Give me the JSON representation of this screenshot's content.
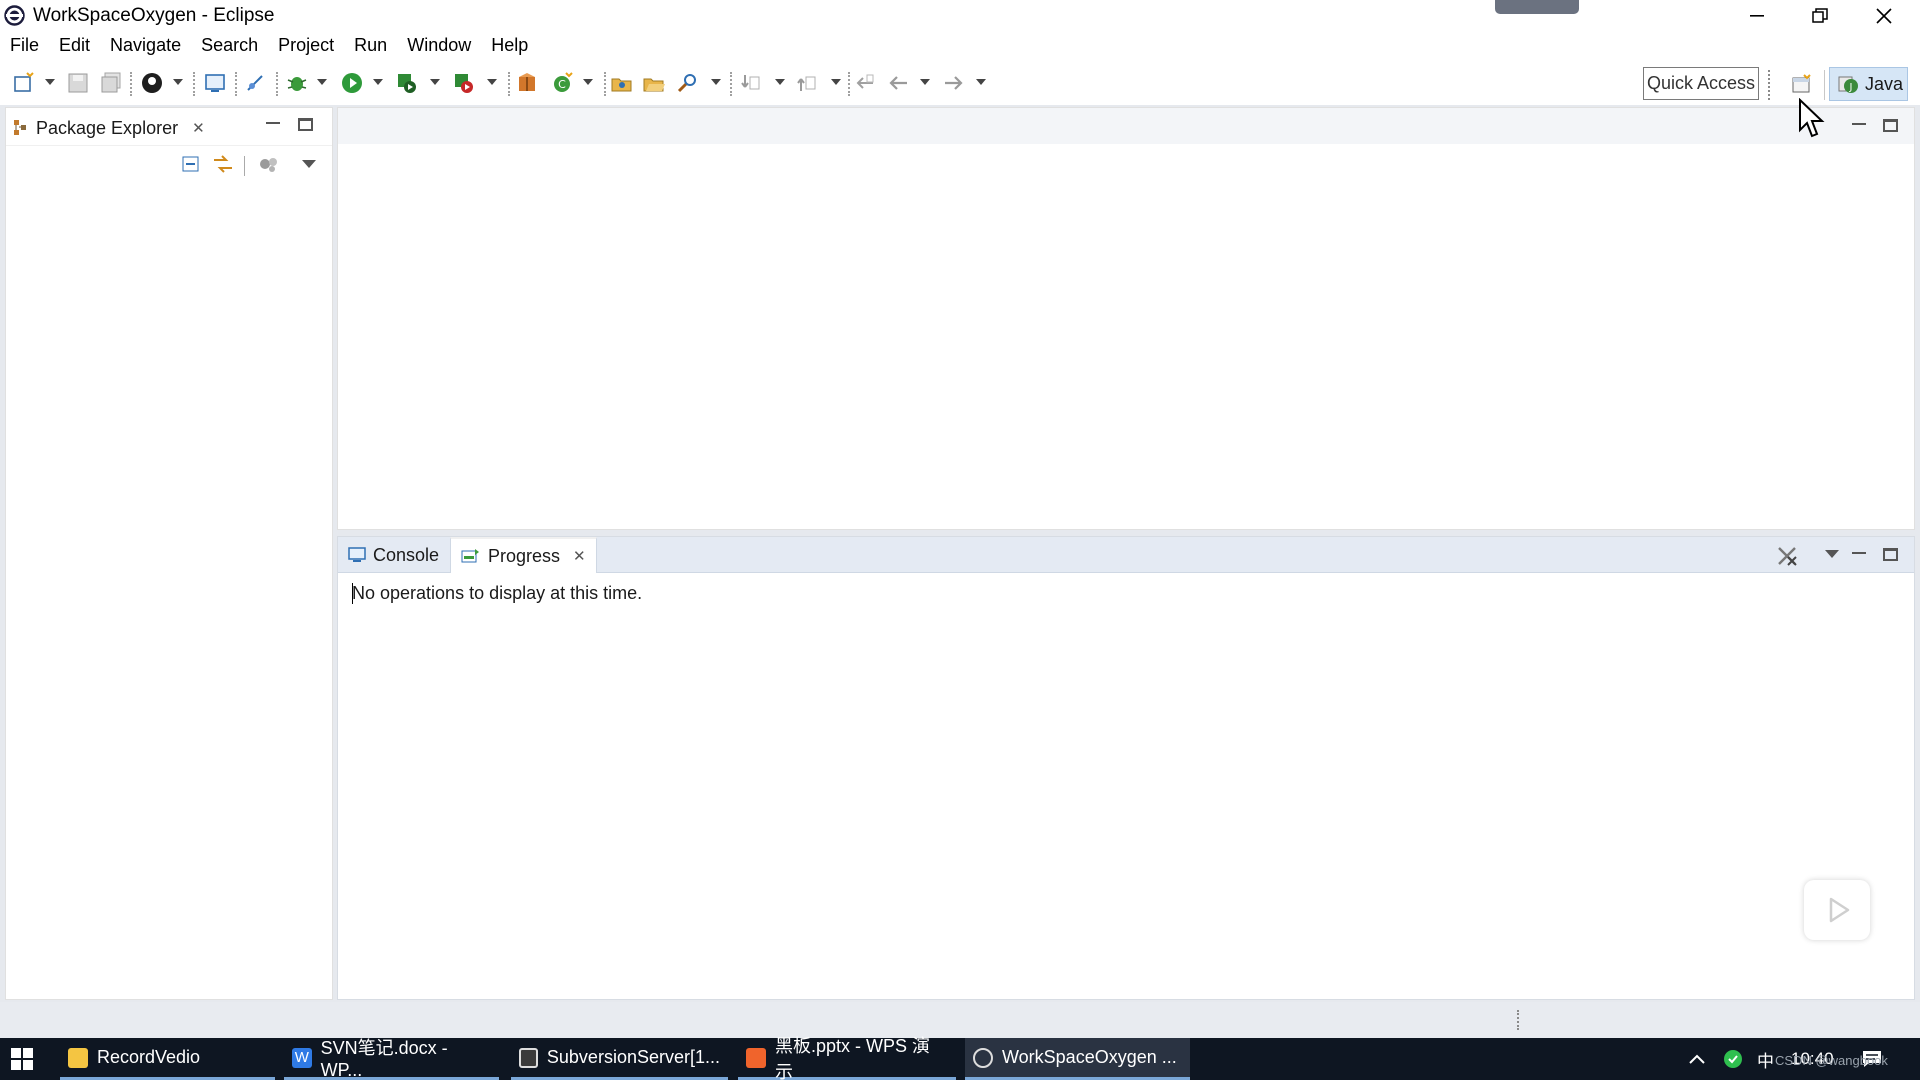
{
  "window": {
    "title": "WorkSpaceOxygen - Eclipse"
  },
  "menu": {
    "items": [
      "File",
      "Edit",
      "Navigate",
      "Search",
      "Project",
      "Run",
      "Window",
      "Help"
    ]
  },
  "toolbar": {
    "quick_access": "Quick Access",
    "perspective_label": "Java"
  },
  "package_explorer": {
    "tab_label": "Package Explorer"
  },
  "bottom_panel": {
    "tabs": [
      "Console",
      "Progress"
    ],
    "active_tab": "Progress",
    "message": "No operations to display at this time."
  },
  "taskbar": {
    "items": [
      {
        "label": "RecordVedio"
      },
      {
        "label": "SVN笔记.docx - WP..."
      },
      {
        "label": "SubversionServer[1..."
      },
      {
        "label": "黑板.pptx - WPS 演示"
      },
      {
        "label": "WorkSpaceOxygen ..."
      }
    ],
    "ime": "中",
    "clock": "10:40",
    "watermark": "CSDN @wangbook"
  },
  "colors": {
    "accent": "#2f6fb3",
    "taskbar_bg": "#0e1622",
    "java_perspective_bg": "#d6e6f6"
  }
}
